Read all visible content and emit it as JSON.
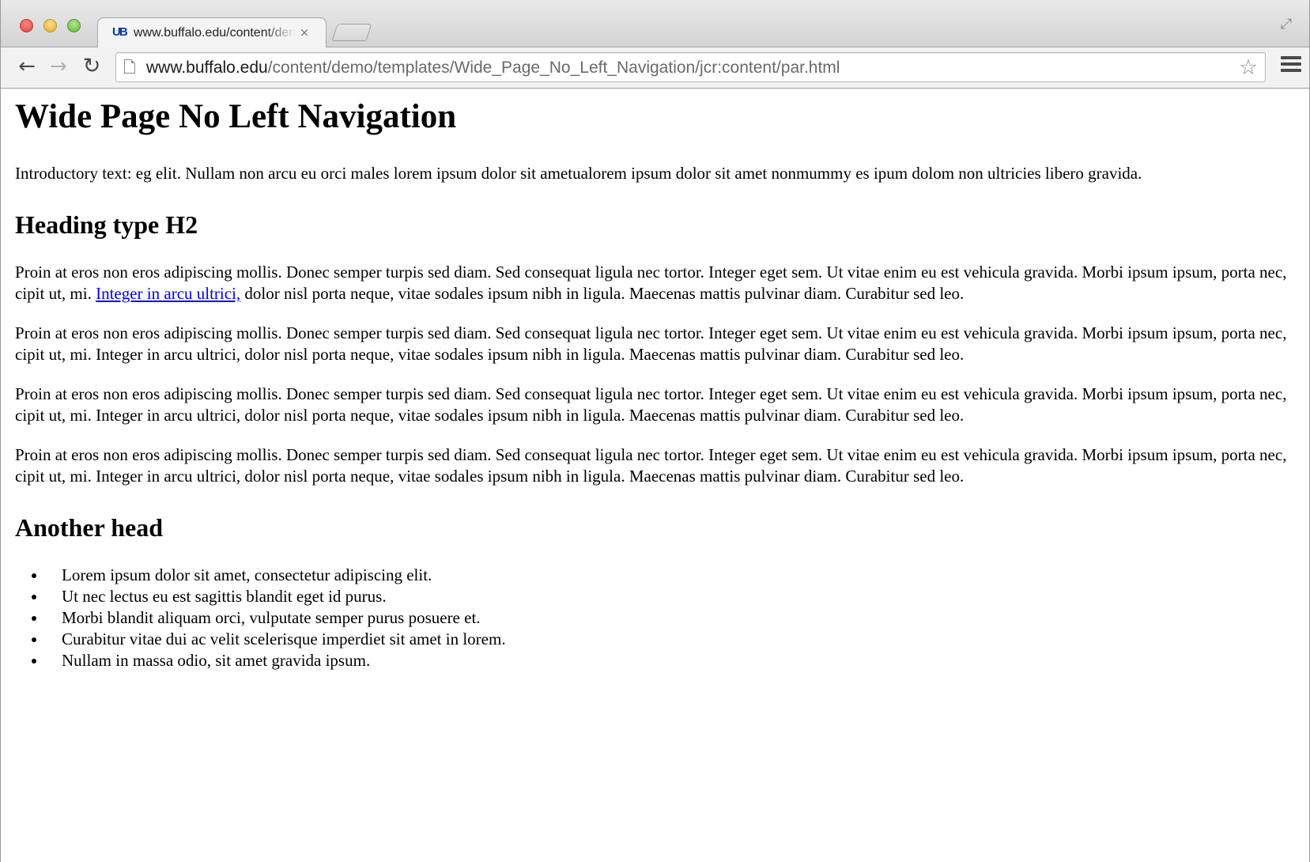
{
  "browser": {
    "tab_title": "www.buffalo.edu/content/demo/templates/Wide_Page_No_Left_Navigation/jcr:content/par.html",
    "tab_favicon": "UB",
    "tab_close": "×",
    "url_host": "www.buffalo.edu",
    "url_path": "/content/demo/templates/Wide_Page_No_Left_Navigation/jcr:content/par.html",
    "icons": {
      "back": "back-arrow-icon",
      "forward": "forward-arrow-icon",
      "reload": "reload-icon",
      "bookmark": "star-icon",
      "menu": "hamburger-menu-icon",
      "fullscreen": "fullscreen-icon"
    },
    "glyphs": {
      "back": "←",
      "forward": "→",
      "reload": "↻",
      "star": "☆",
      "fullscreen": "⤢"
    },
    "colors": {
      "traffic_red": "#e0443e",
      "traffic_yellow": "#e3a92a",
      "traffic_green": "#5fb83a",
      "link": "#0000ee"
    }
  },
  "page": {
    "title": "Wide Page No Left Navigation",
    "intro": "Introductory text: eg elit. Nullam non arcu eu orci males lorem ipsum dolor sit ametualorem ipsum dolor sit amet nonmummy es ipum dolom non ultricies libero gravida.",
    "heading_h2": "Heading type H2",
    "para1_before_link": "Proin at eros non eros adipiscing mollis. Donec semper turpis sed diam. Sed consequat ligula nec tortor. Integer eget sem. Ut vitae enim eu est vehicula gravida. Morbi ipsum ipsum, porta nec, cipit ut, mi. ",
    "para1_link": "Integer in arcu ultrici,",
    "para1_after_link": " dolor nisl porta neque, vitae sodales ipsum nibh in ligula. Maecenas mattis pulvinar diam. Curabitur sed leo.",
    "paragraphs": [
      "Proin at eros non eros adipiscing mollis. Donec semper turpis sed diam. Sed consequat ligula nec tortor. Integer eget sem. Ut vitae enim eu est vehicula gravida. Morbi ipsum ipsum, porta nec, cipit ut, mi. Integer in arcu ultrici, dolor nisl porta neque, vitae sodales ipsum nibh in ligula. Maecenas mattis pulvinar diam. Curabitur sed leo.",
      "Proin at eros non eros adipiscing mollis. Donec semper turpis sed diam. Sed consequat ligula nec tortor. Integer eget sem. Ut vitae enim eu est vehicula gravida. Morbi ipsum ipsum, porta nec, cipit ut, mi. Integer in arcu ultrici, dolor nisl porta neque, vitae sodales ipsum nibh in ligula. Maecenas mattis pulvinar diam. Curabitur sed leo.",
      "Proin at eros non eros adipiscing mollis. Donec semper turpis sed diam. Sed consequat ligula nec tortor. Integer eget sem. Ut vitae enim eu est vehicula gravida. Morbi ipsum ipsum, porta nec, cipit ut, mi. Integer in arcu ultrici, dolor nisl porta neque, vitae sodales ipsum nibh in ligula. Maecenas mattis pulvinar diam. Curabitur sed leo."
    ],
    "heading_another": "Another head",
    "list_items": [
      "Lorem ipsum dolor sit amet, consectetur adipiscing elit.",
      "Ut nec lectus eu est sagittis blandit eget id purus.",
      "Morbi blandit aliquam orci, vulputate semper purus posuere et.",
      "Curabitur vitae dui ac velit scelerisque imperdiet sit amet in lorem.",
      "Nullam in massa odio, sit amet gravida ipsum."
    ]
  }
}
